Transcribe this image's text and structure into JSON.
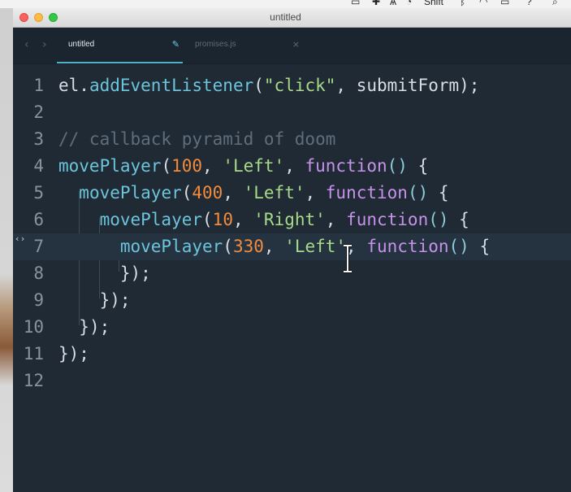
{
  "menubar": {
    "items": [
      "Shift"
    ]
  },
  "window": {
    "title": "untitled"
  },
  "tabs": [
    {
      "label": "untitled",
      "icon": "pencil-icon",
      "active": true
    },
    {
      "label": "promises.js",
      "icon": "close-icon",
      "active": false
    }
  ],
  "nav": {
    "back": "‹",
    "forward": "›"
  },
  "editor": {
    "current_line": 7,
    "lines": [
      {
        "num": "1",
        "tokens": [
          [
            "el.",
            "p"
          ],
          [
            "addEventListener",
            "fn"
          ],
          [
            "(",
            "p"
          ],
          [
            "\"click\"",
            "str"
          ],
          [
            ", submitForm);",
            "p"
          ]
        ]
      },
      {
        "num": "2",
        "tokens": []
      },
      {
        "num": "3",
        "tokens": [
          [
            "// callback pyramid of doom",
            "cmt"
          ]
        ]
      },
      {
        "num": "4",
        "tokens": [
          [
            "movePlayer",
            "fn"
          ],
          [
            "(",
            "p"
          ],
          [
            "100",
            "num"
          ],
          [
            ", ",
            "p"
          ],
          [
            "'Left'",
            "str"
          ],
          [
            ", ",
            "p"
          ],
          [
            "function",
            "kw"
          ],
          [
            "() ",
            "par"
          ],
          [
            "{",
            "p"
          ]
        ]
      },
      {
        "num": "5",
        "tokens": [
          [
            "  ",
            "p"
          ],
          [
            "movePlayer",
            "fn"
          ],
          [
            "(",
            "p"
          ],
          [
            "400",
            "num"
          ],
          [
            ", ",
            "p"
          ],
          [
            "'Left'",
            "str"
          ],
          [
            ", ",
            "p"
          ],
          [
            "function",
            "kw"
          ],
          [
            "() ",
            "par"
          ],
          [
            "{",
            "p"
          ]
        ]
      },
      {
        "num": "6",
        "tokens": [
          [
            "    ",
            "p"
          ],
          [
            "movePlayer",
            "fn"
          ],
          [
            "(",
            "p"
          ],
          [
            "10",
            "num"
          ],
          [
            ", ",
            "p"
          ],
          [
            "'Right'",
            "str"
          ],
          [
            ", ",
            "p"
          ],
          [
            "function",
            "kw"
          ],
          [
            "() ",
            "par"
          ],
          [
            "{",
            "p"
          ]
        ]
      },
      {
        "num": "7",
        "tokens": [
          [
            "      ",
            "p"
          ],
          [
            "movePlayer",
            "fn"
          ],
          [
            "(",
            "p"
          ],
          [
            "330",
            "num"
          ],
          [
            ", ",
            "p"
          ],
          [
            "'Left'",
            "str"
          ],
          [
            ", ",
            "p"
          ],
          [
            "function",
            "kw"
          ],
          [
            "() ",
            "par"
          ],
          [
            "{",
            "p"
          ]
        ]
      },
      {
        "num": "8",
        "tokens": [
          [
            "      ",
            "p"
          ],
          [
            "});",
            "p"
          ]
        ]
      },
      {
        "num": "9",
        "tokens": [
          [
            "    ",
            "p"
          ],
          [
            "});",
            "p"
          ]
        ]
      },
      {
        "num": "10",
        "tokens": [
          [
            "  ",
            "p"
          ],
          [
            "});",
            "p"
          ]
        ]
      },
      {
        "num": "11",
        "tokens": [
          [
            "});",
            "p"
          ]
        ]
      },
      {
        "num": "12",
        "tokens": []
      }
    ]
  },
  "colors": {
    "background": "#1f2a35",
    "function_name": "#6cc4db",
    "number": "#f28b3c",
    "string": "#a8d989",
    "keyword": "#c792ea",
    "comment": "#5f6e7b",
    "tab_accent": "#4fb1c8"
  }
}
